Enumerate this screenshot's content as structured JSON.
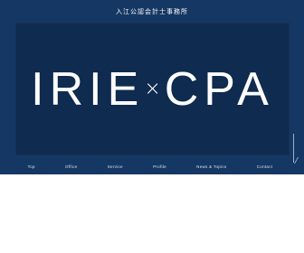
{
  "header": {
    "title": "入江公認会計士事務所"
  },
  "hero": {
    "logo_left": "IRIE",
    "logo_times": "×",
    "logo_right": "CPA"
  },
  "nav": {
    "items": [
      {
        "label": "Top"
      },
      {
        "label": "Office"
      },
      {
        "label": "Service"
      },
      {
        "label": "Profile"
      },
      {
        "label": "News & Topics"
      },
      {
        "label": "Contact"
      }
    ]
  },
  "icons": {
    "scroll": "scroll-down-icon"
  },
  "colors": {
    "band": "#153763",
    "hero": "#0f2b4f",
    "text": "#ffffff"
  }
}
